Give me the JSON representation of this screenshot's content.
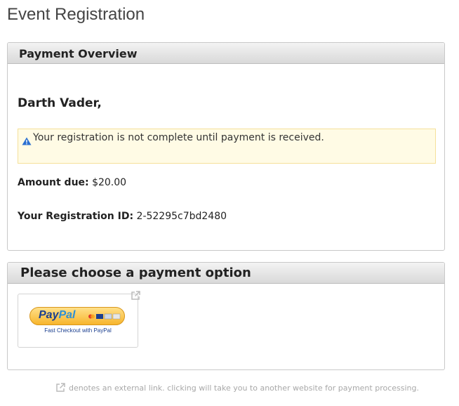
{
  "page": {
    "title": "Event Registration"
  },
  "overview": {
    "heading": "Payment Overview",
    "greeting": "Darth Vader,",
    "notice": "Your registration is not complete until payment is received.",
    "amount_label": "Amount due:",
    "amount_value": "$20.00",
    "regid_label": "Your Registration ID:",
    "regid_value": "2-52295c7bd2480"
  },
  "payment": {
    "heading": "Please choose a payment option",
    "paypal": {
      "logo_pay": "Pay",
      "logo_pal": "Pal",
      "caption": "Fast Checkout with PayPal",
      "icon": "external-link-icon"
    }
  },
  "footer": {
    "note": "denotes an external link. clicking will take you to another website for payment processing.",
    "icon": "external-link-icon"
  },
  "colors": {
    "notice_bg": "#fffbe5",
    "notice_border": "#f5e19a",
    "warning_icon": "#2a6fd1",
    "paypal_navy": "#1b3f8f",
    "paypal_blue": "#2d8fd5",
    "paypal_gold": "#f7b52c"
  }
}
